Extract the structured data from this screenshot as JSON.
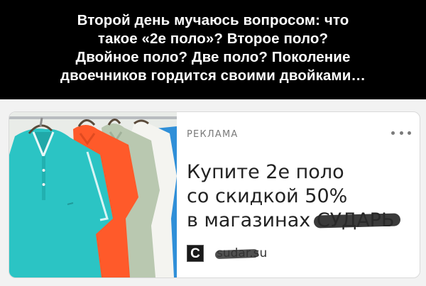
{
  "caption": {
    "lines": [
      "Второй день мучаюсь вопросом: что",
      "такое «2е поло»? Второе поло?",
      "Двойное поло? Две поло? Поколение",
      "двоечников гордится своими двойками…"
    ]
  },
  "ad": {
    "label": "РЕКЛАМА",
    "headline": {
      "line1": "Купите 2е поло",
      "line2": "со скидкой 50%",
      "line3_prefix": "в магазинах ",
      "line3_redacted": "СУДАРЬ"
    },
    "source": {
      "logo_letter": "С",
      "domain": "sudar.su"
    },
    "image_icon": "polo-shirts-photo",
    "more_icon": "more-dots-icon"
  },
  "colors": {
    "caption_bg": "#000000",
    "caption_text": "#ffffff",
    "turquoise_shirt": "#2bc4c4",
    "orange_shirt": "#ff5a2a",
    "sage_shirt": "#b9c8b0",
    "white_shirt": "#f4f4f0",
    "blue_shirt": "#2f8fd8"
  }
}
